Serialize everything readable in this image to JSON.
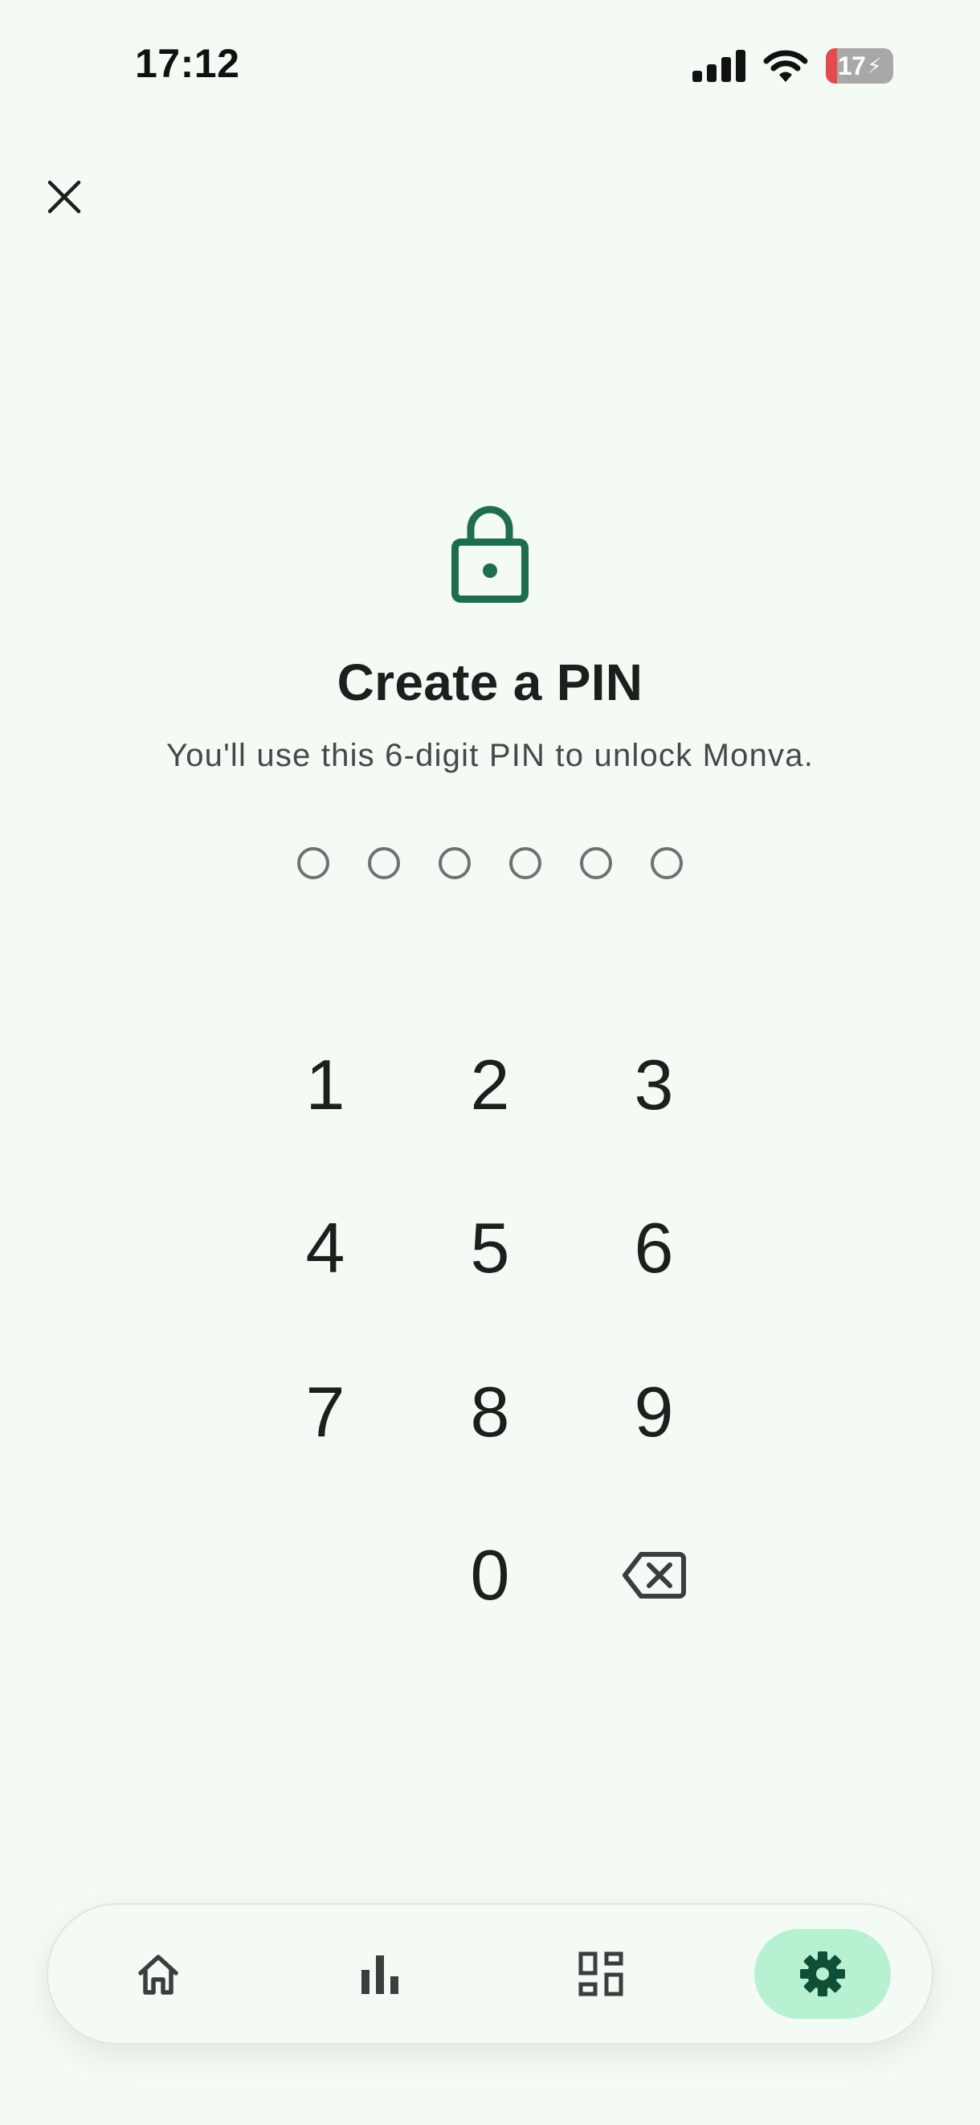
{
  "status_bar": {
    "time": "17:12",
    "battery_level": "17",
    "battery_percent": 17,
    "battery_charging": true,
    "icons": [
      "signal-icon",
      "wifi-icon",
      "battery-icon"
    ]
  },
  "header": {
    "close_icon": "close-icon"
  },
  "pin_setup": {
    "lock_icon": "lock-icon",
    "title": "Create a PIN",
    "subtitle": "You'll use this 6-digit PIN to unlock Monva.",
    "digits_entered": 0,
    "digits_total": 6
  },
  "keypad": {
    "keys": [
      "1",
      "2",
      "3",
      "4",
      "5",
      "6",
      "7",
      "8",
      "9",
      "0"
    ],
    "backspace_icon": "backspace-icon"
  },
  "bottom_nav": {
    "items": [
      {
        "id": "home",
        "icon": "home-icon",
        "active": false
      },
      {
        "id": "stats",
        "icon": "bar-chart-icon",
        "active": false
      },
      {
        "id": "dashboard",
        "icon": "dashboard-icon",
        "active": false
      },
      {
        "id": "settings",
        "icon": "gear-icon",
        "active": true
      }
    ]
  },
  "colors": {
    "background": "#f4faf4",
    "accent": "#1e6e4e",
    "nav_active_bg": "#b7f1d2",
    "battery_low": "#e5484d"
  }
}
